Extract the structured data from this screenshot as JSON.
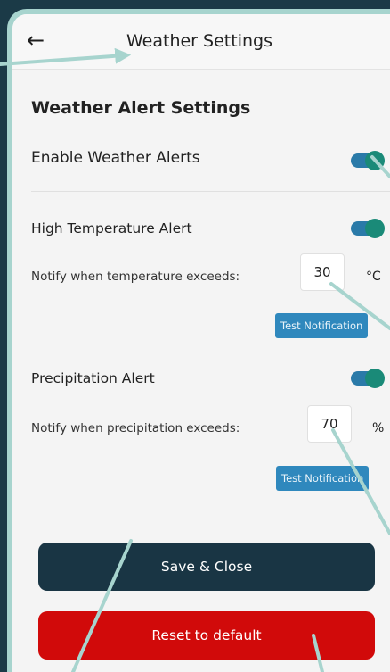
{
  "appbar": {
    "back_icon": "arrow-left-icon",
    "title": "Weather Settings"
  },
  "section": {
    "title": "Weather Alert Settings"
  },
  "enable_alerts": {
    "label": "Enable Weather Alerts",
    "on": true
  },
  "high_temp": {
    "label": "High Temperature Alert",
    "on": true,
    "notify_label": "Notify when temperature exceeds:",
    "value": "30",
    "unit": "°C",
    "test_label": "Test Notification"
  },
  "precip": {
    "label": "Precipitation Alert",
    "on": true,
    "notify_label": "Notify when precipitation exceeds:",
    "value": "70",
    "unit": "%",
    "test_label": "Test Notification"
  },
  "buttons": {
    "save_label": "Save & Close",
    "reset_label": "Reset to default"
  },
  "colors": {
    "background": "#1b3a47",
    "frame": "#a7d4ce",
    "toggle_track": "#2a7aa8",
    "toggle_knob": "#1a8a78",
    "test_button": "#2f88bd",
    "save_button": "#193544",
    "reset_button": "#d10a0a",
    "annotation": "#a7d4ce"
  }
}
